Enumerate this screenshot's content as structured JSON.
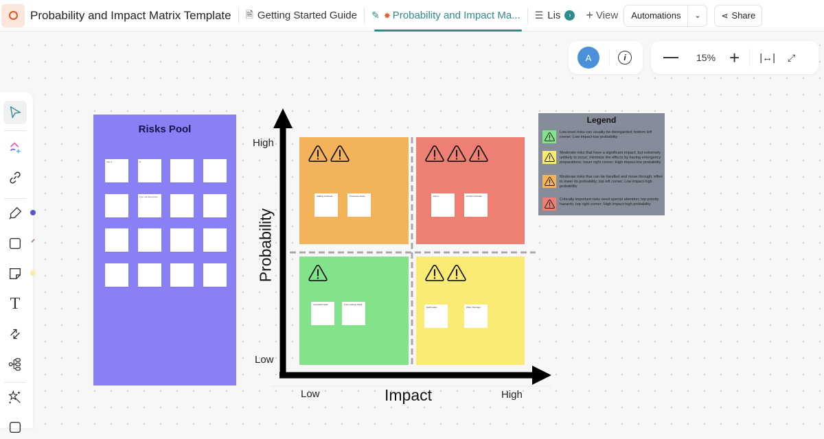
{
  "topbar": {
    "workspace_title": "Probability and Impact Matrix Template",
    "tabs": [
      {
        "label": "Getting Started Guide",
        "icon": "doc-icon"
      },
      {
        "label": "Probability and Impact Ma...",
        "icon": "whiteboard-icon",
        "active": true
      },
      {
        "label": "Lis",
        "icon": "list-icon"
      }
    ],
    "add_view_label": "View",
    "automations_label": "Automations",
    "share_label": "Share"
  },
  "controls": {
    "avatar_initial": "A",
    "zoom_level": "15%"
  },
  "pool": {
    "title": "Risks Pool",
    "stickies": [
      "Idea 1",
      "Ri",
      "",
      "",
      "",
      "Type risk description",
      "",
      "",
      "",
      "",
      "",
      "",
      "",
      "",
      "",
      ""
    ]
  },
  "matrix": {
    "y_axis": "Probability",
    "x_axis": "Impact",
    "y_high": "High",
    "y_low": "Low",
    "x_low": "Low",
    "x_high": "High",
    "quadrants": {
      "top_left": {
        "color": "#f2b35b",
        "warnings": 2,
        "stickies": [
          "Staffing Outbreak",
          "Production Delay"
        ]
      },
      "top_right": {
        "color": "#ed8072",
        "warnings": 3,
        "stickies": [
          "Flood",
          "COVID Outbreak"
        ]
      },
      "bottom_left": {
        "color": "#82e38a",
        "warnings": 1,
        "stickies": [
          "Cancelled Flight",
          "Fuel Leakage Flight"
        ]
      },
      "bottom_right": {
        "color": "#faeb74",
        "warnings": 2,
        "stickies": [
          "Earthquake",
          "Water Shortage"
        ]
      }
    }
  },
  "legend": {
    "title": "Legend",
    "items": [
      {
        "color": "#82e38a",
        "text": "Low-level risks can usually be disregarded; bottom left corner; Low impact-low probability"
      },
      {
        "color": "#faeb74",
        "text": "Moderate risks that have a significant impact, but extremely unlikely to occur; minimize the effects by having emergency preparations; lower right corner; High impact-low probability"
      },
      {
        "color": "#f2b35b",
        "text": "Moderate risks that can be handled and move through; effort to lower its probability; top left corner; Low impact-high probability"
      },
      {
        "color": "#ed8072",
        "text": "Critically important risks need special attention; top priority hazards; top right corner; High impact-high probability"
      }
    ]
  }
}
